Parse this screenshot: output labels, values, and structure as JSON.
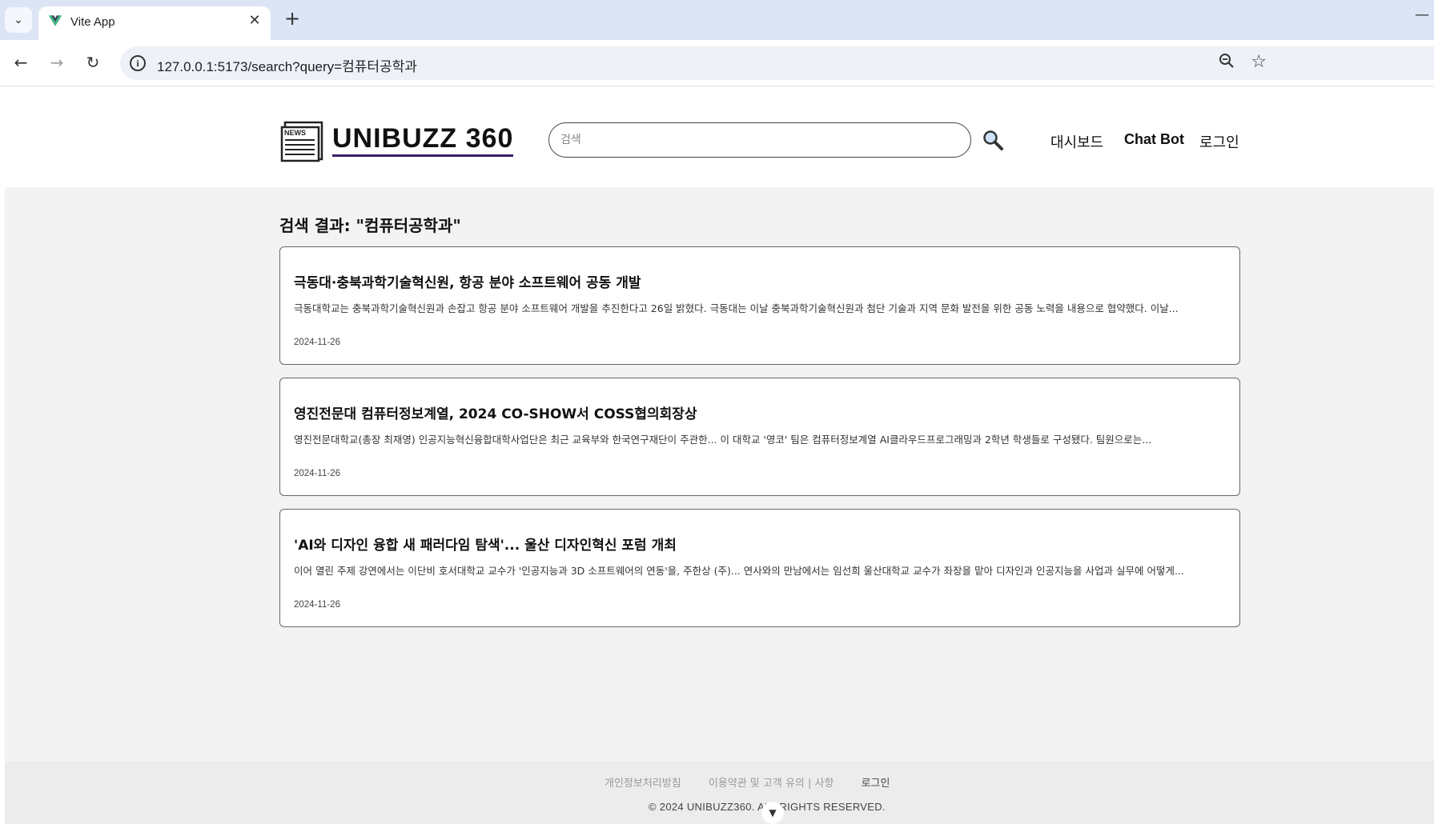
{
  "browser": {
    "tab_title": "Vite App",
    "url": "127.0.0.1:5173/search?query=컴퓨터공학과",
    "new_tab_symbol": "+",
    "close_symbol": "✕"
  },
  "header": {
    "logo_text": "UNIBUZZ 360",
    "logo_badge": "NEWS",
    "search_placeholder": "검색",
    "nav": {
      "dashboard": "대시보드",
      "chatbot": "Chat Bot",
      "login": "로그인"
    }
  },
  "results": {
    "title": "검색 결과: \"컴퓨터공학과\"",
    "items": [
      {
        "title": "극동대·충북과학기술혁신원, 항공 분야 소프트웨어 공동 개발",
        "desc": "극동대학교는 충북과학기술혁신원과 손잡고 항공 분야 소프트웨어 개발을 추진한다고 26일 밝혔다. 극동대는 이날 충북과학기술혁신원과 첨단 기술과 지역 문화 발전을 위한 공동 노력을 내용으로 협약했다. 이날...",
        "date": "2024-11-26"
      },
      {
        "title": "영진전문대 컴퓨터정보계열, 2024 CO-SHOW서 COSS협의회장상",
        "desc": "영진전문대학교(총장 최재영) 인공지능혁신융합대학사업단은 최근 교육부와 한국연구재단이 주관한... 이 대학교 '영코' 팀은 컴퓨터정보계열 AI클라우드프로그래밍과 2학년 학생들로 구성됐다. 팀원으로는...",
        "date": "2024-11-26"
      },
      {
        "title": "'AI와 디자인 융합 새 패러다임 탐색'... 울산 디자인혁신 포럼 개최",
        "desc": "이어 열린 주제 강연에서는 이단비 호서대학교 교수가 '인공지능과 3D 소프트웨어의 연동'을, 주한상 (주)... 연사와의 만남에서는 임선희 울산대학교 교수가 좌장을 맡아 디자인과 인공지능을 사업과 실무에 어떻게...",
        "date": "2024-11-26"
      }
    ]
  },
  "footer": {
    "privacy": "개인정보처리방침",
    "terms": "이용약관 및 고객 유의 | 사항",
    "login": "로그인",
    "copyright": "© 2024 UNIBUZZ360. ALL RIGHTS RESERVED."
  },
  "icons": {
    "tab_menu": "chevron-down-icon",
    "favicon": "vue-logo-icon",
    "back": "arrow-left-icon",
    "forward": "arrow-right-icon",
    "reload": "reload-icon",
    "info": "info-icon",
    "zoom": "zoom-icon",
    "star": "star-icon",
    "search": "magnifier-icon",
    "logo": "newspaper-icon"
  },
  "colors": {
    "tabbar": "#dbe5f6",
    "content_bg": "#f3f3f3",
    "footer_bg": "#ececec",
    "logo_underline": "#3b1f6b"
  }
}
